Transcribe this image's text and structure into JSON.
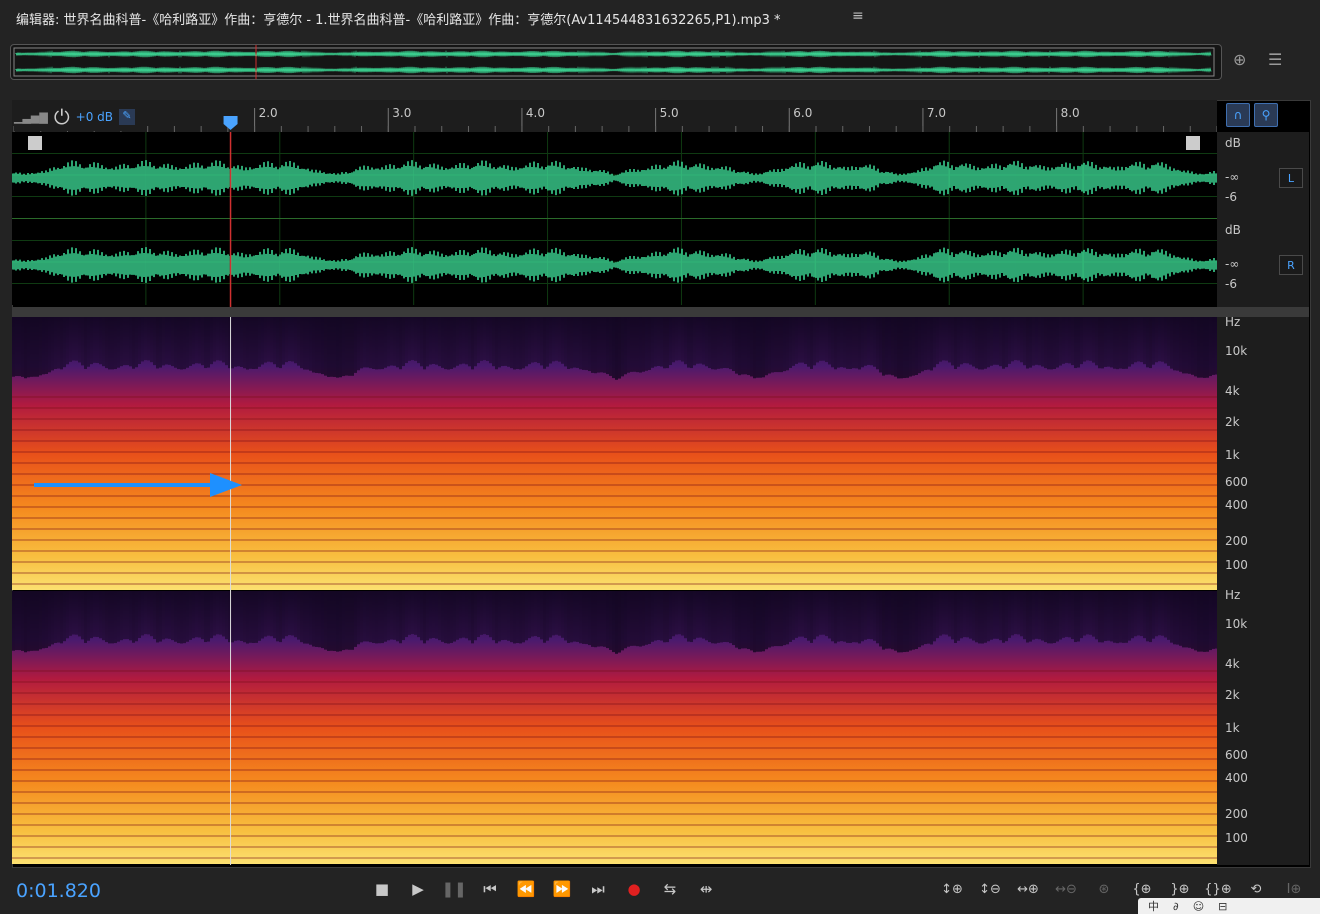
{
  "window": {
    "title": "编辑器: 世界名曲科普-《哈利路亚》作曲：亨德尔 - 1.世界名曲科普-《哈利路亚》作曲：亨德尔(Av114544831632265,P1).mp3 *",
    "menu_icon": "hamburger-icon"
  },
  "hud": {
    "gain": "+0 dB"
  },
  "ruler": {
    "labels": [
      "2.0",
      "3.0",
      "4.0",
      "5.0",
      "6.0",
      "7.0",
      "8.0"
    ],
    "start": 0.185,
    "end": 9.2,
    "playhead": 1.82
  },
  "waveform": {
    "channels": [
      {
        "badge": "L",
        "db_labels": [
          "dB",
          "-∞",
          "-6"
        ]
      },
      {
        "badge": "R",
        "db_labels": [
          "dB",
          "-∞",
          "-6"
        ]
      }
    ]
  },
  "spectrum": {
    "hz_labels": [
      "Hz",
      "10k",
      "4k",
      "2k",
      "1k",
      "600",
      "400",
      "200",
      "100"
    ]
  },
  "status": {
    "time": "0:01.820"
  },
  "transport": [
    "stop-icon",
    "play-icon",
    "pause-icon",
    "skip-to-start-icon",
    "rewind-icon",
    "fast-forward-icon",
    "skip-to-end-icon",
    "record-icon",
    "loop-icon",
    "skip-selection-icon"
  ],
  "zoom": [
    "zoom-in-amplitude-icon",
    "zoom-out-amplitude-icon",
    "zoom-in-time-icon",
    "zoom-out-time-icon",
    "zoom-full-icon",
    "zoom-in-left-icon",
    "zoom-in-right-icon",
    "zoom-selection-icon",
    "zoom-reset-icon",
    "zoom-fit-icon"
  ],
  "colors": {
    "accent": "#4aa3ff",
    "waveform": "#3ddc97",
    "playhead": "#d03030"
  },
  "tray": {
    "items": [
      "中",
      "∂",
      "☺",
      "⊟"
    ]
  }
}
